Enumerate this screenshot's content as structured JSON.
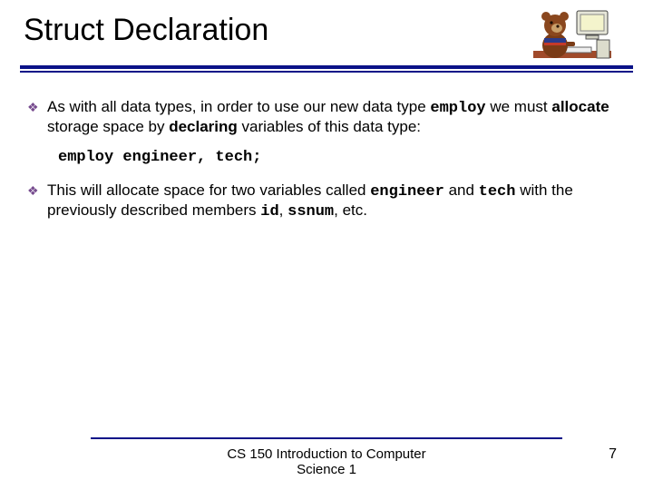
{
  "title": "Struct Declaration",
  "bullets": {
    "b1": {
      "t1": "As with all data types, in order to use our new data type ",
      "code1": "employ",
      "t2": " we must ",
      "bold1": "allocate",
      "t3": " storage space by ",
      "bold2": "declaring",
      "t4": " variables of this data type:"
    },
    "code_line": "employ engineer, tech;",
    "b2": {
      "t1": "This will allocate space for two variables called ",
      "code1": "engineer",
      "t2": " and ",
      "code2": "tech",
      "t3": " with the previously  described members ",
      "code3": "id",
      "t4": ", ",
      "code4": "ssnum",
      "t5": ", etc."
    }
  },
  "footer": {
    "line1": "CS 150 Introduction to Computer",
    "line2": "Science 1"
  },
  "page_number": "7",
  "bullet_glyph": "❖"
}
